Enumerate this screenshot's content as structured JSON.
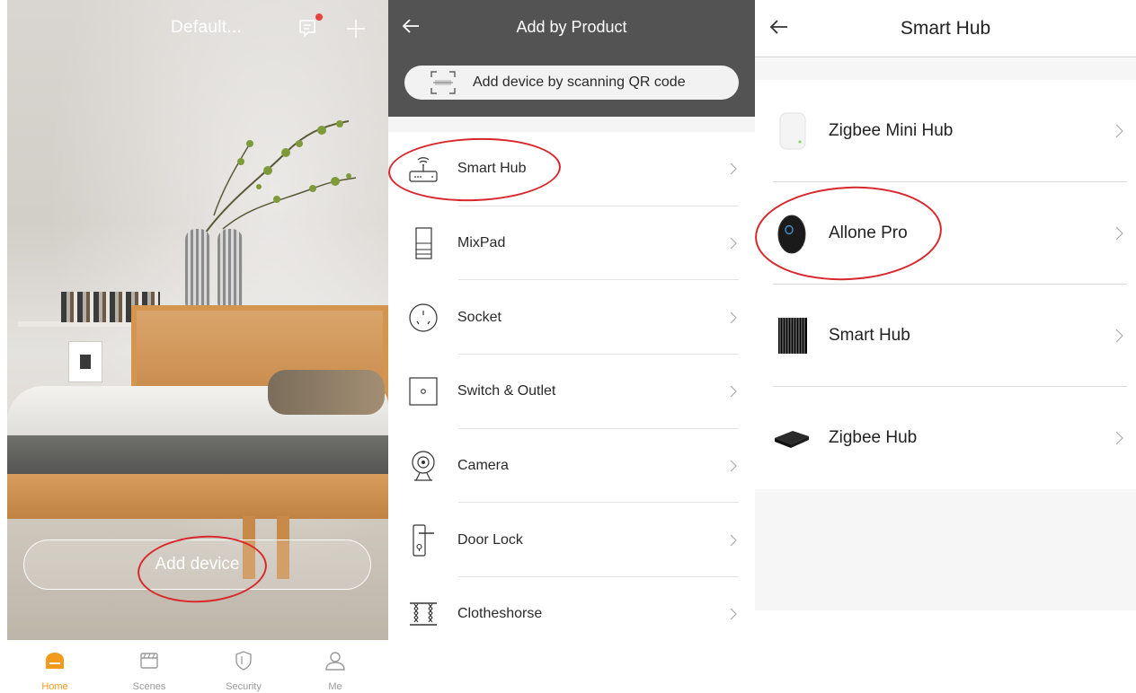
{
  "home": {
    "title": "Default...",
    "add_device_label": "Add device",
    "tabs": [
      {
        "label": "Home",
        "icon": "home-icon",
        "active": true
      },
      {
        "label": "Scenes",
        "icon": "scenes-icon",
        "active": false
      },
      {
        "label": "Security",
        "icon": "shield-icon",
        "active": false
      },
      {
        "label": "Me",
        "icon": "person-icon",
        "active": false
      }
    ],
    "accent": "#f19a1c",
    "notification_dot_color": "#e8433f"
  },
  "product": {
    "title": "Add by Product",
    "qr_button_label": "Add device by scanning QR code",
    "header_color": "#535353",
    "items": [
      {
        "label": "Smart Hub",
        "icon": "router-icon"
      },
      {
        "label": "MixPad",
        "icon": "panel-icon"
      },
      {
        "label": "Socket",
        "icon": "socket-icon"
      },
      {
        "label": "Switch & Outlet",
        "icon": "switch-icon"
      },
      {
        "label": "Camera",
        "icon": "camera-icon"
      },
      {
        "label": "Door Lock",
        "icon": "door-lock-icon"
      },
      {
        "label": "Clotheshorse",
        "icon": "clotheshorse-icon"
      }
    ]
  },
  "hub": {
    "title": "Smart Hub",
    "items": [
      {
        "label": "Zigbee Mini Hub",
        "icon": "zigbee-mini-hub-image"
      },
      {
        "label": "Allone Pro",
        "icon": "allone-pro-image"
      },
      {
        "label": "Smart Hub",
        "icon": "smart-hub-image"
      },
      {
        "label": "Zigbee Hub",
        "icon": "zigbee-hub-image"
      }
    ]
  },
  "annotation_color": "#d8282d"
}
